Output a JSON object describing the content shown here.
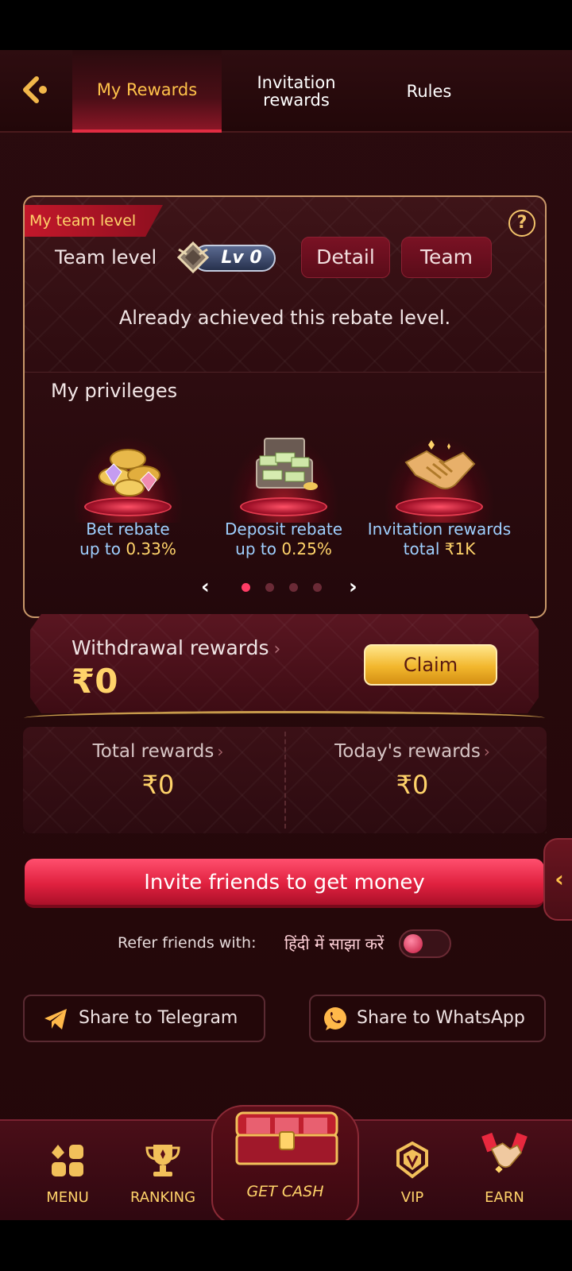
{
  "header": {
    "tabs": [
      {
        "label": "My Rewards",
        "active": true
      },
      {
        "label": "Invitation\nrewards",
        "active": false
      },
      {
        "label": "Rules",
        "active": false
      }
    ]
  },
  "team_card": {
    "ribbon": "My team level",
    "team_level_label": "Team level",
    "level_badge": "Lv 0",
    "detail_label": "Detail",
    "team_label": "Team",
    "status_text": "Already achieved this rebate level.",
    "privileges_title": "My privileges",
    "privileges": [
      {
        "name": "Bet rebate",
        "prefix": "up to ",
        "value": "0.33%",
        "icon": "coins-gems-icon"
      },
      {
        "name": "Deposit rebate",
        "prefix": "up to ",
        "value": "0.25%",
        "icon": "money-chest-icon"
      },
      {
        "name": "Invitation rewards",
        "prefix": "total ",
        "value": "₹1K",
        "icon": "handshake-icon"
      }
    ],
    "pager": {
      "pages": 4,
      "current": 0
    }
  },
  "withdraw": {
    "title": "Withdrawal rewards",
    "amount": "₹0",
    "claim_label": "Claim"
  },
  "rewards": {
    "total_label": "Total rewards",
    "total_value": "₹0",
    "today_label": "Today's rewards",
    "today_value": "₹0"
  },
  "invite_button": "Invite friends to get money",
  "refer": {
    "label": "Refer friends with:",
    "language": "हिंदी में साझा करें",
    "toggle_on": false
  },
  "share": {
    "telegram": "Share to Telegram",
    "whatsapp": "Share to WhatsApp"
  },
  "bottom_nav": {
    "menu": "MENU",
    "ranking": "RANKING",
    "getcash": "GET CASH",
    "vip": "VIP",
    "earn": "EARN"
  },
  "colors": {
    "accent_gold": "#ffd36a",
    "accent_red": "#e0213f",
    "background": "#230709"
  }
}
